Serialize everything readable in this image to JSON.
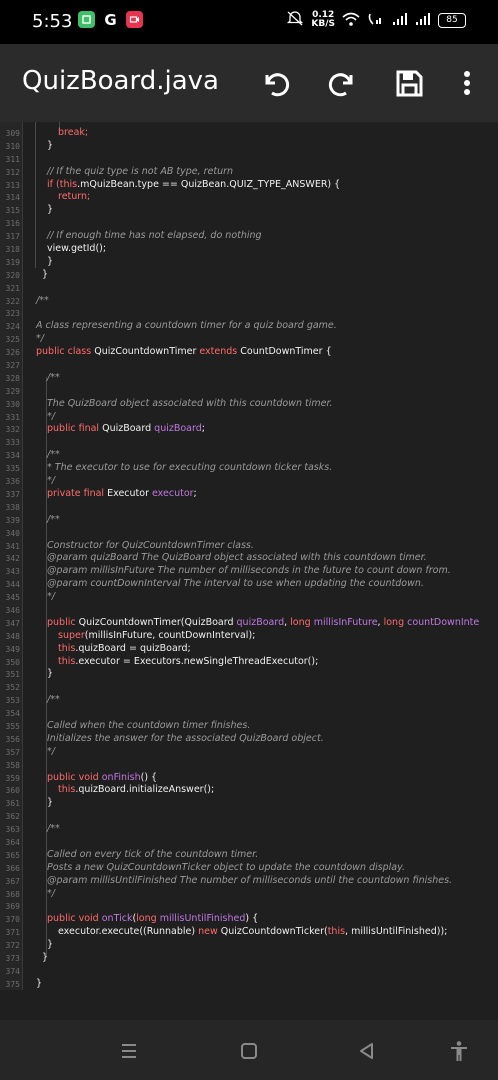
{
  "status_bar": {
    "time": "5:53",
    "net_speed_value": "0.12",
    "net_speed_unit": "KB/S",
    "battery": "85",
    "icons": [
      "money-app-icon",
      "google-icon",
      "screen-record-icon",
      "mute-icon",
      "wifi-icon",
      "volte-icon",
      "signal-icon",
      "signal-icon",
      "battery-icon"
    ]
  },
  "toolbar": {
    "title": "QuizBoard.java",
    "actions": [
      "undo-icon",
      "redo-icon",
      "save-icon",
      "more-vert-icon"
    ]
  },
  "editor": {
    "lines": [
      {
        "n": "309",
        "indent": 2,
        "tokens": [
          {
            "t": "break;",
            "k": "kw"
          }
        ]
      },
      {
        "n": "310",
        "indent": 1,
        "tokens": [
          {
            "t": "}",
            "k": "txt"
          }
        ]
      },
      {
        "n": "311",
        "indent": 0,
        "tokens": []
      },
      {
        "n": "312",
        "indent": 1,
        "tokens": [
          {
            "t": "// If the quiz type is not AB type, return",
            "k": "cmt"
          }
        ]
      },
      {
        "n": "313",
        "indent": 1,
        "tokens": [
          {
            "t": "if (",
            "k": "kw"
          },
          {
            "t": "this",
            "k": "kw"
          },
          {
            "t": ".mQuizBean.type == QuizBean.QUIZ_TYPE_ANSWER) {",
            "k": "txt"
          }
        ]
      },
      {
        "n": "314",
        "indent": 2,
        "tokens": [
          {
            "t": "return;",
            "k": "kw"
          }
        ]
      },
      {
        "n": "315",
        "indent": 1,
        "tokens": [
          {
            "t": "}",
            "k": "txt"
          }
        ]
      },
      {
        "n": "316",
        "indent": 0,
        "tokens": []
      },
      {
        "n": "317",
        "indent": 1,
        "tokens": [
          {
            "t": "// If enough time has not elapsed, do nothing",
            "k": "cmt"
          }
        ]
      },
      {
        "n": "318",
        "indent": 1,
        "tokens": [
          {
            "t": "view.getId();",
            "k": "txt"
          }
        ]
      },
      {
        "n": "319",
        "indent": 1,
        "tokens": [
          {
            "t": "}",
            "k": "txt"
          }
        ]
      },
      {
        "n": "320",
        "indent": 0,
        "tokens": [
          {
            "t": "  }",
            "k": "txt"
          }
        ]
      },
      {
        "n": "321",
        "indent": 0,
        "tokens": []
      },
      {
        "n": "322",
        "indent": 0,
        "tokens": [
          {
            "t": "/**",
            "k": "cmt"
          }
        ]
      },
      {
        "n": "323",
        "indent": 0,
        "tokens": []
      },
      {
        "n": "324",
        "indent": 0,
        "tokens": [
          {
            "t": "A class representing a countdown timer for a quiz board game.",
            "k": "cmt"
          }
        ]
      },
      {
        "n": "325",
        "indent": 0,
        "tokens": [
          {
            "t": "*/",
            "k": "cmt"
          }
        ]
      },
      {
        "n": "326",
        "indent": 0,
        "tokens": [
          {
            "t": "public class ",
            "k": "kw"
          },
          {
            "t": "QuizCountdownTimer ",
            "k": "txt"
          },
          {
            "t": "extends ",
            "k": "kw"
          },
          {
            "t": "CountDownTimer {",
            "k": "txt"
          }
        ]
      },
      {
        "n": "327",
        "indent": 0,
        "tokens": []
      },
      {
        "n": "328",
        "indent": 1,
        "tokens": [
          {
            "t": "/**",
            "k": "cmt"
          }
        ]
      },
      {
        "n": "329",
        "indent": 0,
        "tokens": []
      },
      {
        "n": "330",
        "indent": 1,
        "tokens": [
          {
            "t": "The QuizBoard object associated with this countdown timer.",
            "k": "cmt"
          }
        ]
      },
      {
        "n": "331",
        "indent": 1,
        "tokens": [
          {
            "t": "*/",
            "k": "cmt"
          }
        ]
      },
      {
        "n": "332",
        "indent": 1,
        "tokens": [
          {
            "t": "public final ",
            "k": "kw"
          },
          {
            "t": "QuizBoard ",
            "k": "txt"
          },
          {
            "t": "quizBoard",
            "k": "fld"
          },
          {
            "t": ";",
            "k": "txt"
          }
        ]
      },
      {
        "n": "333",
        "indent": 0,
        "tokens": []
      },
      {
        "n": "334",
        "indent": 1,
        "tokens": [
          {
            "t": "/**",
            "k": "cmt"
          }
        ]
      },
      {
        "n": "335",
        "indent": 1,
        "tokens": [
          {
            "t": "* The executor to use for executing countdown ticker tasks.",
            "k": "cmt"
          }
        ]
      },
      {
        "n": "336",
        "indent": 1,
        "tokens": [
          {
            "t": "*/",
            "k": "cmt"
          }
        ]
      },
      {
        "n": "337",
        "indent": 1,
        "tokens": [
          {
            "t": "private final ",
            "k": "kw"
          },
          {
            "t": "Executor ",
            "k": "txt"
          },
          {
            "t": "executor",
            "k": "fld"
          },
          {
            "t": ";",
            "k": "txt"
          }
        ]
      },
      {
        "n": "338",
        "indent": 0,
        "tokens": []
      },
      {
        "n": "339",
        "indent": 1,
        "tokens": [
          {
            "t": "/**",
            "k": "cmt"
          }
        ]
      },
      {
        "n": "340",
        "indent": 0,
        "tokens": []
      },
      {
        "n": "341",
        "indent": 1,
        "tokens": [
          {
            "t": "Constructor for QuizCountdownTimer class.",
            "k": "cmt"
          }
        ]
      },
      {
        "n": "342",
        "indent": 1,
        "tokens": [
          {
            "t": "@param quizBoard The QuizBoard object associated with this countdown timer.",
            "k": "cmt"
          }
        ]
      },
      {
        "n": "343",
        "indent": 1,
        "tokens": [
          {
            "t": "@param millisInFuture The number of milliseconds in the future to count down from.",
            "k": "cmt"
          }
        ]
      },
      {
        "n": "344",
        "indent": 1,
        "tokens": [
          {
            "t": "@param countDownInterval The interval to use when updating the countdown.",
            "k": "cmt"
          }
        ]
      },
      {
        "n": "345",
        "indent": 1,
        "tokens": [
          {
            "t": "*/",
            "k": "cmt"
          }
        ]
      },
      {
        "n": "346",
        "indent": 0,
        "tokens": []
      },
      {
        "n": "347",
        "indent": 1,
        "tokens": [
          {
            "t": "public ",
            "k": "kw"
          },
          {
            "t": "QuizCountdownTimer(QuizBoard ",
            "k": "txt"
          },
          {
            "t": "quizBoard",
            "k": "fld"
          },
          {
            "t": ", ",
            "k": "txt"
          },
          {
            "t": "long ",
            "k": "kw"
          },
          {
            "t": "millisInFuture",
            "k": "fld"
          },
          {
            "t": ", ",
            "k": "txt"
          },
          {
            "t": "long ",
            "k": "kw"
          },
          {
            "t": "countDownInte",
            "k": "fld"
          }
        ]
      },
      {
        "n": "348",
        "indent": 2,
        "tokens": [
          {
            "t": "super",
            "k": "kw"
          },
          {
            "t": "(millisInFuture, countDownInterval);",
            "k": "txt"
          }
        ]
      },
      {
        "n": "349",
        "indent": 2,
        "tokens": [
          {
            "t": "this",
            "k": "kw"
          },
          {
            "t": ".quizBoard = quizBoard;",
            "k": "txt"
          }
        ]
      },
      {
        "n": "350",
        "indent": 2,
        "tokens": [
          {
            "t": "this",
            "k": "kw"
          },
          {
            "t": ".executor = Executors.newSingleThreadExecutor();",
            "k": "txt"
          }
        ]
      },
      {
        "n": "351",
        "indent": 1,
        "tokens": [
          {
            "t": "}",
            "k": "txt"
          }
        ]
      },
      {
        "n": "352",
        "indent": 0,
        "tokens": []
      },
      {
        "n": "353",
        "indent": 1,
        "tokens": [
          {
            "t": "/**",
            "k": "cmt"
          }
        ]
      },
      {
        "n": "354",
        "indent": 0,
        "tokens": []
      },
      {
        "n": "355",
        "indent": 1,
        "tokens": [
          {
            "t": "Called when the countdown timer finishes.",
            "k": "cmt"
          }
        ]
      },
      {
        "n": "356",
        "indent": 1,
        "tokens": [
          {
            "t": "Initializes the answer for the associated QuizBoard object.",
            "k": "cmt"
          }
        ]
      },
      {
        "n": "357",
        "indent": 1,
        "tokens": [
          {
            "t": "*/",
            "k": "cmt"
          }
        ]
      },
      {
        "n": "358",
        "indent": 0,
        "tokens": []
      },
      {
        "n": "359",
        "indent": 1,
        "tokens": [
          {
            "t": "public void ",
            "k": "kw"
          },
          {
            "t": "onFinish",
            "k": "fld"
          },
          {
            "t": "() {",
            "k": "txt"
          }
        ]
      },
      {
        "n": "360",
        "indent": 2,
        "tokens": [
          {
            "t": "this",
            "k": "kw"
          },
          {
            "t": ".quizBoard.initializeAnswer();",
            "k": "txt"
          }
        ]
      },
      {
        "n": "361",
        "indent": 1,
        "tokens": [
          {
            "t": "}",
            "k": "txt"
          }
        ]
      },
      {
        "n": "362",
        "indent": 0,
        "tokens": []
      },
      {
        "n": "363",
        "indent": 1,
        "tokens": [
          {
            "t": "/**",
            "k": "cmt"
          }
        ]
      },
      {
        "n": "364",
        "indent": 0,
        "tokens": []
      },
      {
        "n": "365",
        "indent": 1,
        "tokens": [
          {
            "t": "Called on every tick of the countdown timer.",
            "k": "cmt"
          }
        ]
      },
      {
        "n": "366",
        "indent": 1,
        "tokens": [
          {
            "t": "Posts a new QuizCountdownTicker object to update the countdown display.",
            "k": "cmt"
          }
        ]
      },
      {
        "n": "367",
        "indent": 1,
        "tokens": [
          {
            "t": "@param millisUntilFinished The number of milliseconds until the countdown finishes.",
            "k": "cmt"
          }
        ]
      },
      {
        "n": "368",
        "indent": 1,
        "tokens": [
          {
            "t": "*/",
            "k": "cmt"
          }
        ]
      },
      {
        "n": "369",
        "indent": 0,
        "tokens": []
      },
      {
        "n": "370",
        "indent": 1,
        "tokens": [
          {
            "t": "public void ",
            "k": "kw"
          },
          {
            "t": "onTick",
            "k": "fld"
          },
          {
            "t": "(",
            "k": "txt"
          },
          {
            "t": "long ",
            "k": "kw"
          },
          {
            "t": "millisUntilFinished",
            "k": "fld"
          },
          {
            "t": ") {",
            "k": "txt"
          }
        ]
      },
      {
        "n": "371",
        "indent": 2,
        "tokens": [
          {
            "t": "executor.execute((Runnable) ",
            "k": "txt"
          },
          {
            "t": "new ",
            "k": "kw"
          },
          {
            "t": "QuizCountdownTicker(",
            "k": "txt"
          },
          {
            "t": "this",
            "k": "kw"
          },
          {
            "t": ", millisUntilFinished));",
            "k": "txt"
          }
        ]
      },
      {
        "n": "372",
        "indent": 1,
        "tokens": [
          {
            "t": "}",
            "k": "txt"
          }
        ]
      },
      {
        "n": "373",
        "indent": 0,
        "tokens": [
          {
            "t": "  }",
            "k": "txt"
          }
        ]
      },
      {
        "n": "374",
        "indent": 0,
        "tokens": []
      },
      {
        "n": "375",
        "indent": 0,
        "tokens": [
          {
            "t": "}",
            "k": "txt"
          }
        ]
      },
      {
        "n": "376",
        "indent": 0,
        "tokens": []
      }
    ]
  },
  "nav_bar": {
    "buttons": [
      "recents-icon",
      "home-icon",
      "back-icon",
      "accessibility-icon"
    ]
  },
  "colors": {
    "background": "#1f1f1f",
    "toolbar": "#2b2b2b",
    "keyword": "#ff6b6b",
    "field": "#c078e0",
    "comment": "#9a9a9a",
    "text": "#f0f0f0"
  }
}
